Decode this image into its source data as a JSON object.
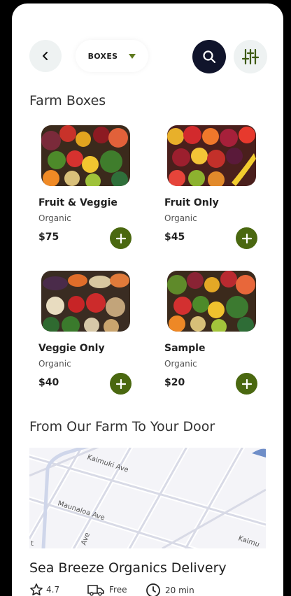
{
  "header": {
    "back_icon": "chevron-left-icon",
    "category": "BOXES",
    "accent": "#5f7a1f",
    "search_icon": "search-icon",
    "filter_icon": "sliders-icon"
  },
  "sections": {
    "farm_boxes": "Farm Boxes",
    "delivery": "From Our Farm To Your Door"
  },
  "products": [
    {
      "name": "Fruit & Veggie",
      "subtitle": "Organic",
      "price": "$75"
    },
    {
      "name": "Fruit Only",
      "subtitle": "Organic",
      "price": "$45"
    },
    {
      "name": "Veggie Only",
      "subtitle": "Organic",
      "price": "$40"
    },
    {
      "name": "Sample",
      "subtitle": "Organic",
      "price": "$20"
    }
  ],
  "map": {
    "streets": [
      "Kaimuki Ave",
      "Maunaloa Ave",
      "Ave",
      "Kaimu",
      "t"
    ]
  },
  "delivery": {
    "title": "Sea Breeze Organics Delivery",
    "rating": "4.7",
    "shipping": "Free",
    "time": "20 min"
  },
  "colors": {
    "primary_dark": "#10142b",
    "button_green": "#4a6810"
  }
}
